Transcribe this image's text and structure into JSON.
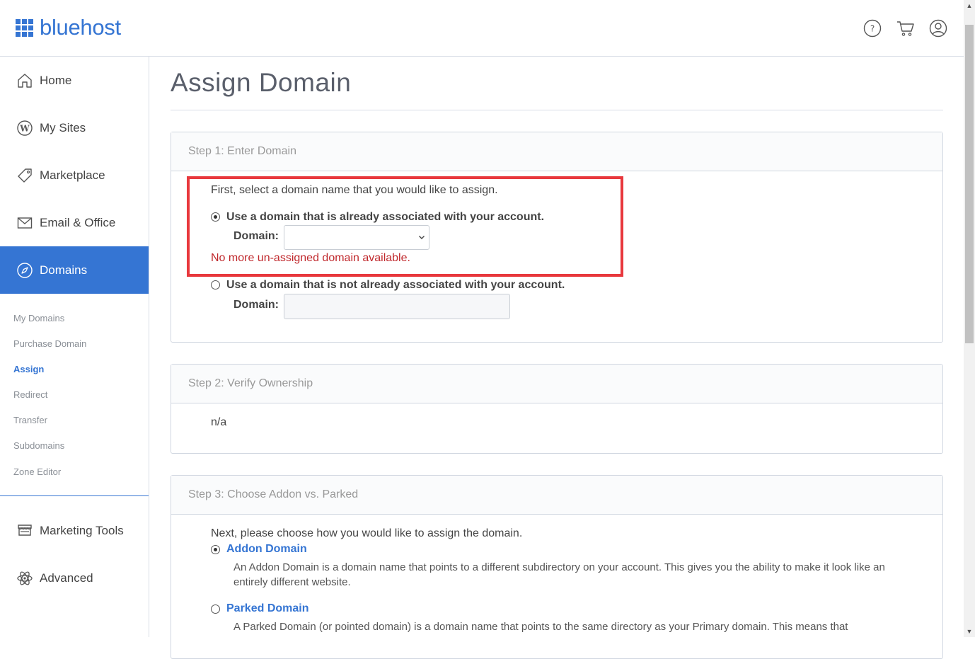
{
  "brand": {
    "name": "bluehost",
    "color": "#3575d3"
  },
  "header": {
    "icons": [
      "help-icon",
      "cart-icon",
      "account-icon"
    ]
  },
  "sidebar": {
    "items": [
      {
        "label": "Home",
        "icon": "home-icon"
      },
      {
        "label": "My Sites",
        "icon": "wordpress-icon"
      },
      {
        "label": "Marketplace",
        "icon": "tag-icon"
      },
      {
        "label": "Email & Office",
        "icon": "envelope-icon"
      },
      {
        "label": "Domains",
        "icon": "compass-icon",
        "active": true
      },
      {
        "label": "Marketing Tools",
        "icon": "storefront-icon"
      },
      {
        "label": "Advanced",
        "icon": "atom-icon"
      }
    ],
    "subitems": [
      "My Domains",
      "Purchase Domain",
      "Assign",
      "Redirect",
      "Transfer",
      "Subdomains",
      "Zone Editor"
    ],
    "active_subitem": "Assign"
  },
  "page": {
    "title": "Assign Domain",
    "step1": {
      "heading": "Step 1: Enter Domain",
      "intro": "First, select a domain name that you would like to assign.",
      "option1": "Use a domain that is already associated with your account.",
      "domain_label": "Domain:",
      "select_value": "",
      "error": "No more un-assigned domain available.",
      "option2": "Use a domain that is not already associated with your account.",
      "domain_label2": "Domain:",
      "input_value": ""
    },
    "step2": {
      "heading": "Step 2: Verify Ownership",
      "body": "n/a"
    },
    "step3": {
      "heading": "Step 3: Choose Addon vs. Parked",
      "intro": "Next, please choose how you would like to assign the domain.",
      "addon_label": "Addon Domain",
      "addon_desc": "An Addon Domain is a domain name that points to a different subdirectory on your account. This gives you the ability to make it look like an entirely different website.",
      "parked_label": "Parked Domain",
      "parked_desc": "A Parked Domain (or pointed domain) is a domain name that points to the same directory as your Primary domain. This means that"
    }
  }
}
